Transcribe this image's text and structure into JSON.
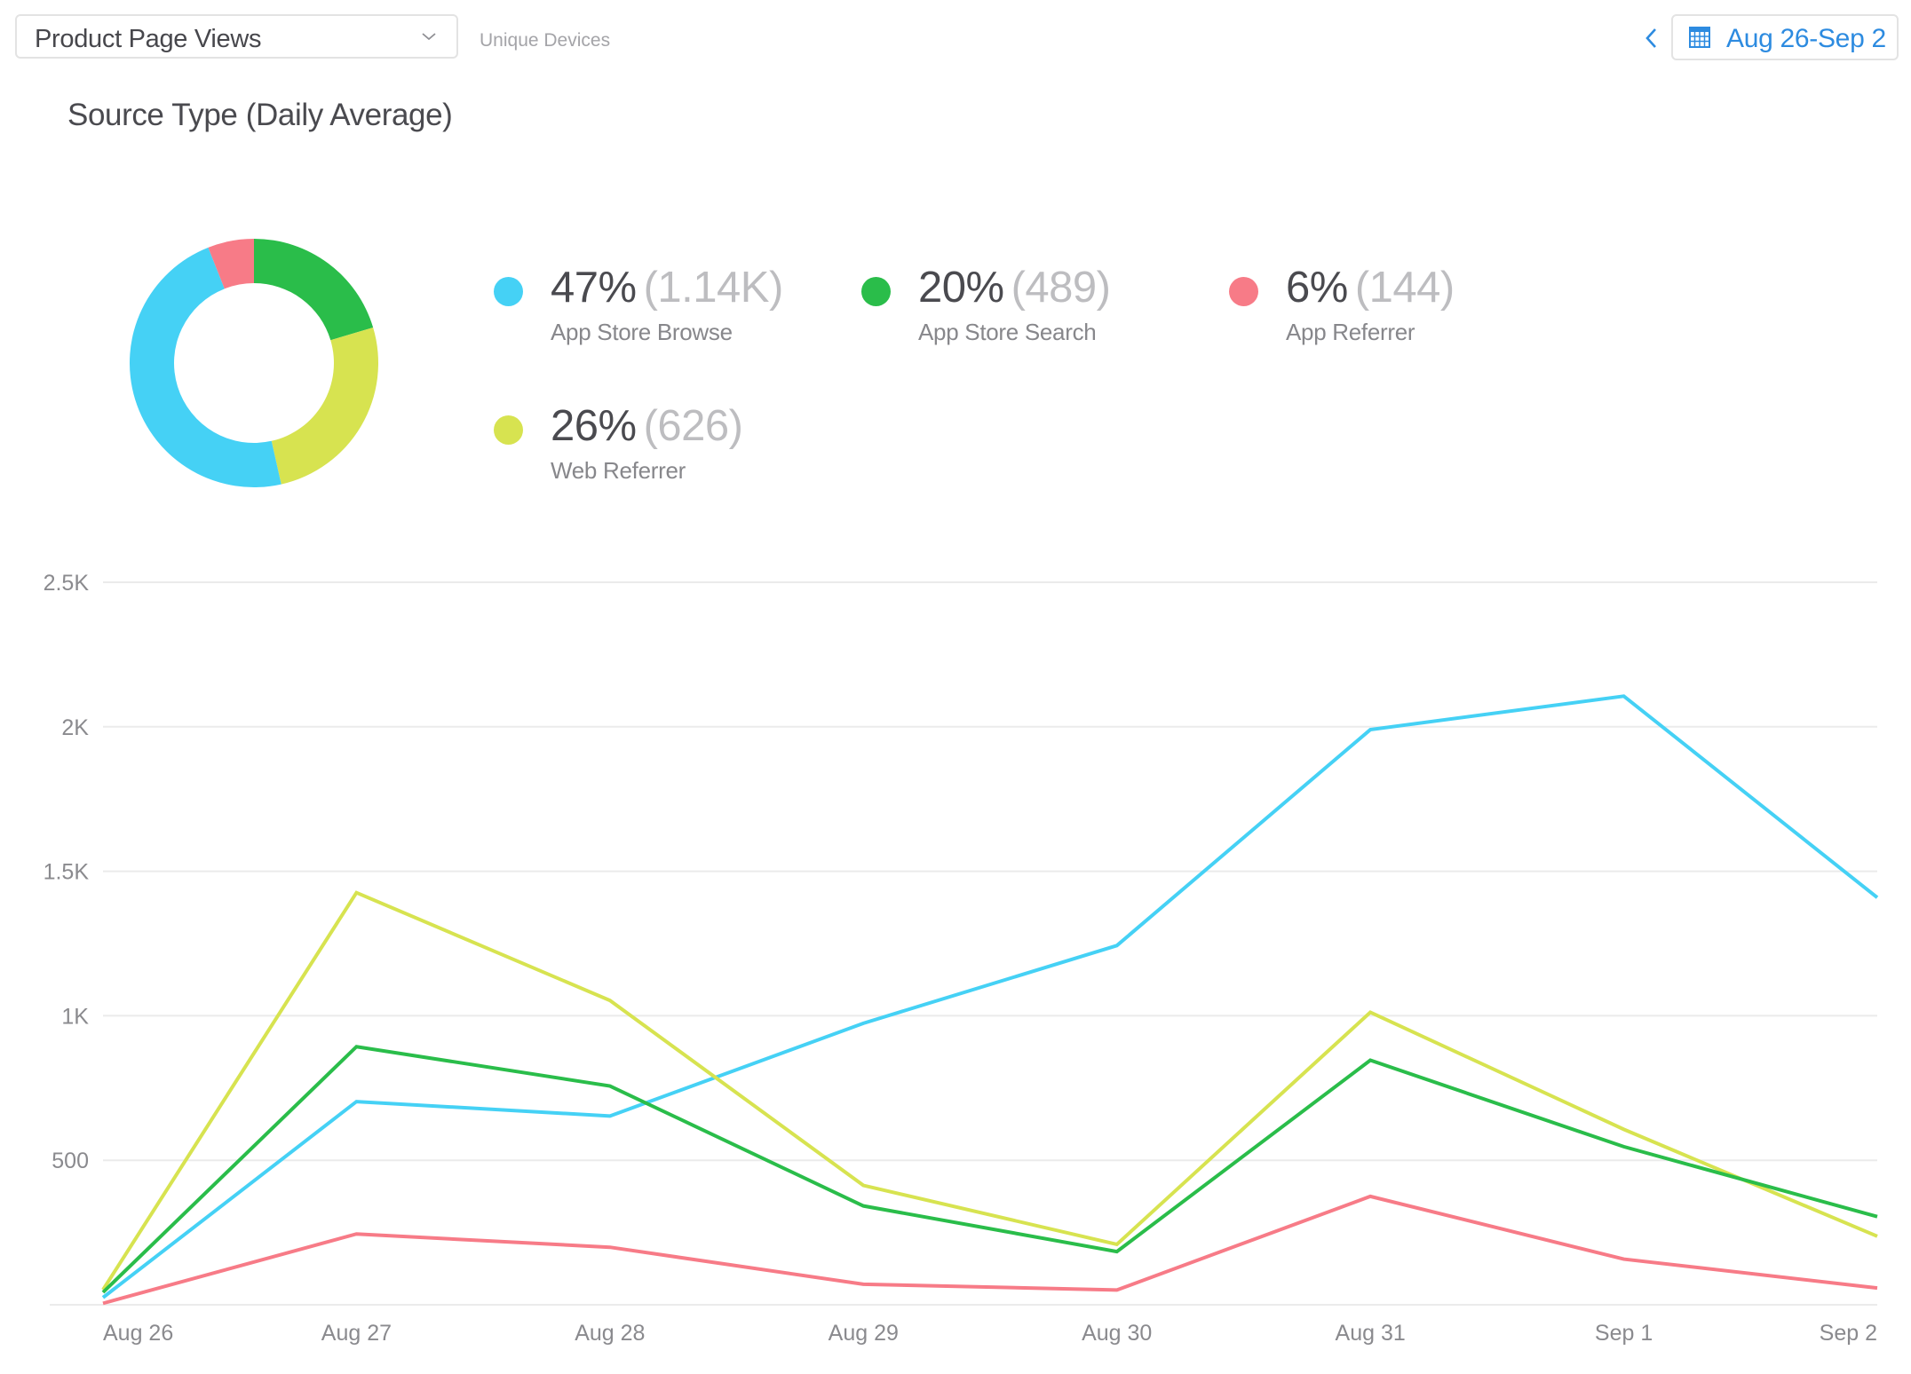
{
  "header": {
    "metric_select": {
      "value": "Product Page Views"
    },
    "sub_metric": "Unique Devices",
    "date_range": "Aug 26-Sep 2"
  },
  "section_title": "Source Type (Daily Average)",
  "legend": [
    {
      "pct": "47%",
      "count": "(1.14K)",
      "name": "App Store Browse",
      "color": "#45d1f5"
    },
    {
      "pct": "20%",
      "count": "(489)",
      "name": "App Store Search",
      "color": "#2abd4a"
    },
    {
      "pct": "6%",
      "count": "(144)",
      "name": "App Referrer",
      "color": "#f77b87"
    },
    {
      "pct": "26%",
      "count": "(626)",
      "name": "Web Referrer",
      "color": "#d7e350"
    }
  ],
  "chart_data": [
    {
      "type": "pie",
      "variant": "donut",
      "title": "Source Type (Daily Average)",
      "start": "top, clockwise",
      "slices": [
        {
          "label": "App Store Search",
          "value": 489,
          "percent": 20,
          "color": "#2abd4a"
        },
        {
          "label": "Web Referrer",
          "value": 626,
          "percent": 26,
          "color": "#d7e350"
        },
        {
          "label": "App Store Browse",
          "value": 1140,
          "percent": 47,
          "color": "#45d1f5"
        },
        {
          "label": "App Referrer",
          "value": 144,
          "percent": 6,
          "color": "#f77b87"
        }
      ]
    },
    {
      "type": "line",
      "title": "",
      "xlabel": "",
      "ylabel": "",
      "categories": [
        "Aug 26",
        "Aug 27",
        "Aug 28",
        "Aug 29",
        "Aug 30",
        "Aug 31",
        "Sep 1",
        "Sep 2"
      ],
      "ylim": [
        0,
        2500
      ],
      "yticks": [
        500,
        1000,
        1500,
        2000,
        2500
      ],
      "ytick_labels": [
        "500",
        "1K",
        "1.5K",
        "2K",
        "2.5K"
      ],
      "grid": true,
      "series": [
        {
          "name": "App Store Browse",
          "color": "#45d1f5",
          "values": [
            25,
            703,
            653,
            974,
            1243,
            1990,
            2106,
            1409
          ]
        },
        {
          "name": "Web Referrer",
          "color": "#d7e350",
          "values": [
            52,
            1426,
            1053,
            413,
            209,
            1012,
            607,
            237
          ]
        },
        {
          "name": "App Store Search",
          "color": "#2abd4a",
          "values": [
            43,
            893,
            757,
            342,
            184,
            846,
            547,
            305
          ]
        },
        {
          "name": "App Referrer",
          "color": "#f77b87",
          "values": [
            5,
            245,
            199,
            71,
            51,
            375,
            158,
            58
          ]
        }
      ]
    }
  ]
}
